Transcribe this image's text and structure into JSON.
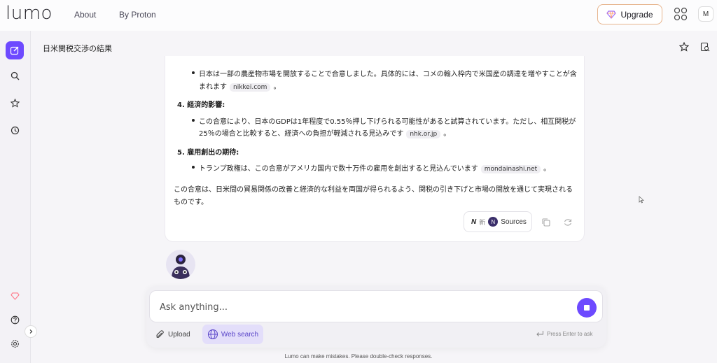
{
  "app": {
    "logo": "lumo",
    "nav": [
      "About",
      "By Proton"
    ],
    "upgrade_label": "Upgrade",
    "user_initial": "M",
    "accent": "#6d4aff"
  },
  "chat": {
    "title": "日米関税交渉の結果",
    "blocks": {
      "b1_line1": "日本は一部の農産物市場を開放することで合意しました。具体的には、コメの輸入枠内で米国産の調達を増やすことが含",
      "b1_line2": "まれます",
      "b1_chip": "nikkei.com",
      "b1_end": "。",
      "h4": "4. 経済的影響:",
      "b2_line1": "この合意により、日本のGDPは1年程度で0.55％押し下げられる可能性があると試算されています。ただし、相互関税が",
      "b2_line2": "25％の場合と比較すると、経済への負担が軽減される見込みです",
      "b2_chip": "nhk.or.jp",
      "b2_end": "。",
      "h5": "5. 雇用創出の期待:",
      "b3_line1": "トランプ政権は、この合意がアメリカ国内で数十万件の雇用を創出すると見込んでいます",
      "b3_chip": "mondainashi.net",
      "b3_end": "。",
      "p_line1": "この合意は、日米間の貿易関係の改善と経済的な利益を両国が得られるよう、関税の引き下げと市場の開放を通じて実現される",
      "p_line2": "ものです。"
    },
    "sources": {
      "logo_text": "N",
      "jp_text": "新",
      "circle": "N",
      "label": "Sources"
    }
  },
  "composer": {
    "placeholder": "Ask anything...",
    "upload_label": "Upload",
    "web_search_label": "Web search",
    "press_hint": "Press Enter to ask"
  },
  "footer": {
    "disclaimer": "Lumo can make mistakes. Please double-check responses."
  }
}
